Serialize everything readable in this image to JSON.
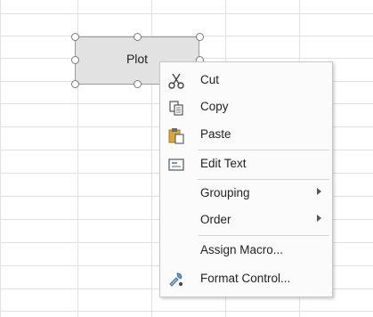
{
  "shape": {
    "label": "Plot"
  },
  "context_menu": {
    "items": [
      {
        "label": "Cut",
        "icon": "scissors-icon"
      },
      {
        "label": "Copy",
        "icon": "copy-icon"
      },
      {
        "label": "Paste",
        "icon": "paste-icon"
      },
      {
        "label": "Edit Text",
        "icon": "edit-text-icon"
      },
      {
        "label": "Grouping",
        "submenu": true
      },
      {
        "label": "Order",
        "submenu": true
      },
      {
        "label": "Assign Macro...",
        "icon": ""
      },
      {
        "label": "Format Control...",
        "icon": "format-control-icon"
      }
    ]
  }
}
